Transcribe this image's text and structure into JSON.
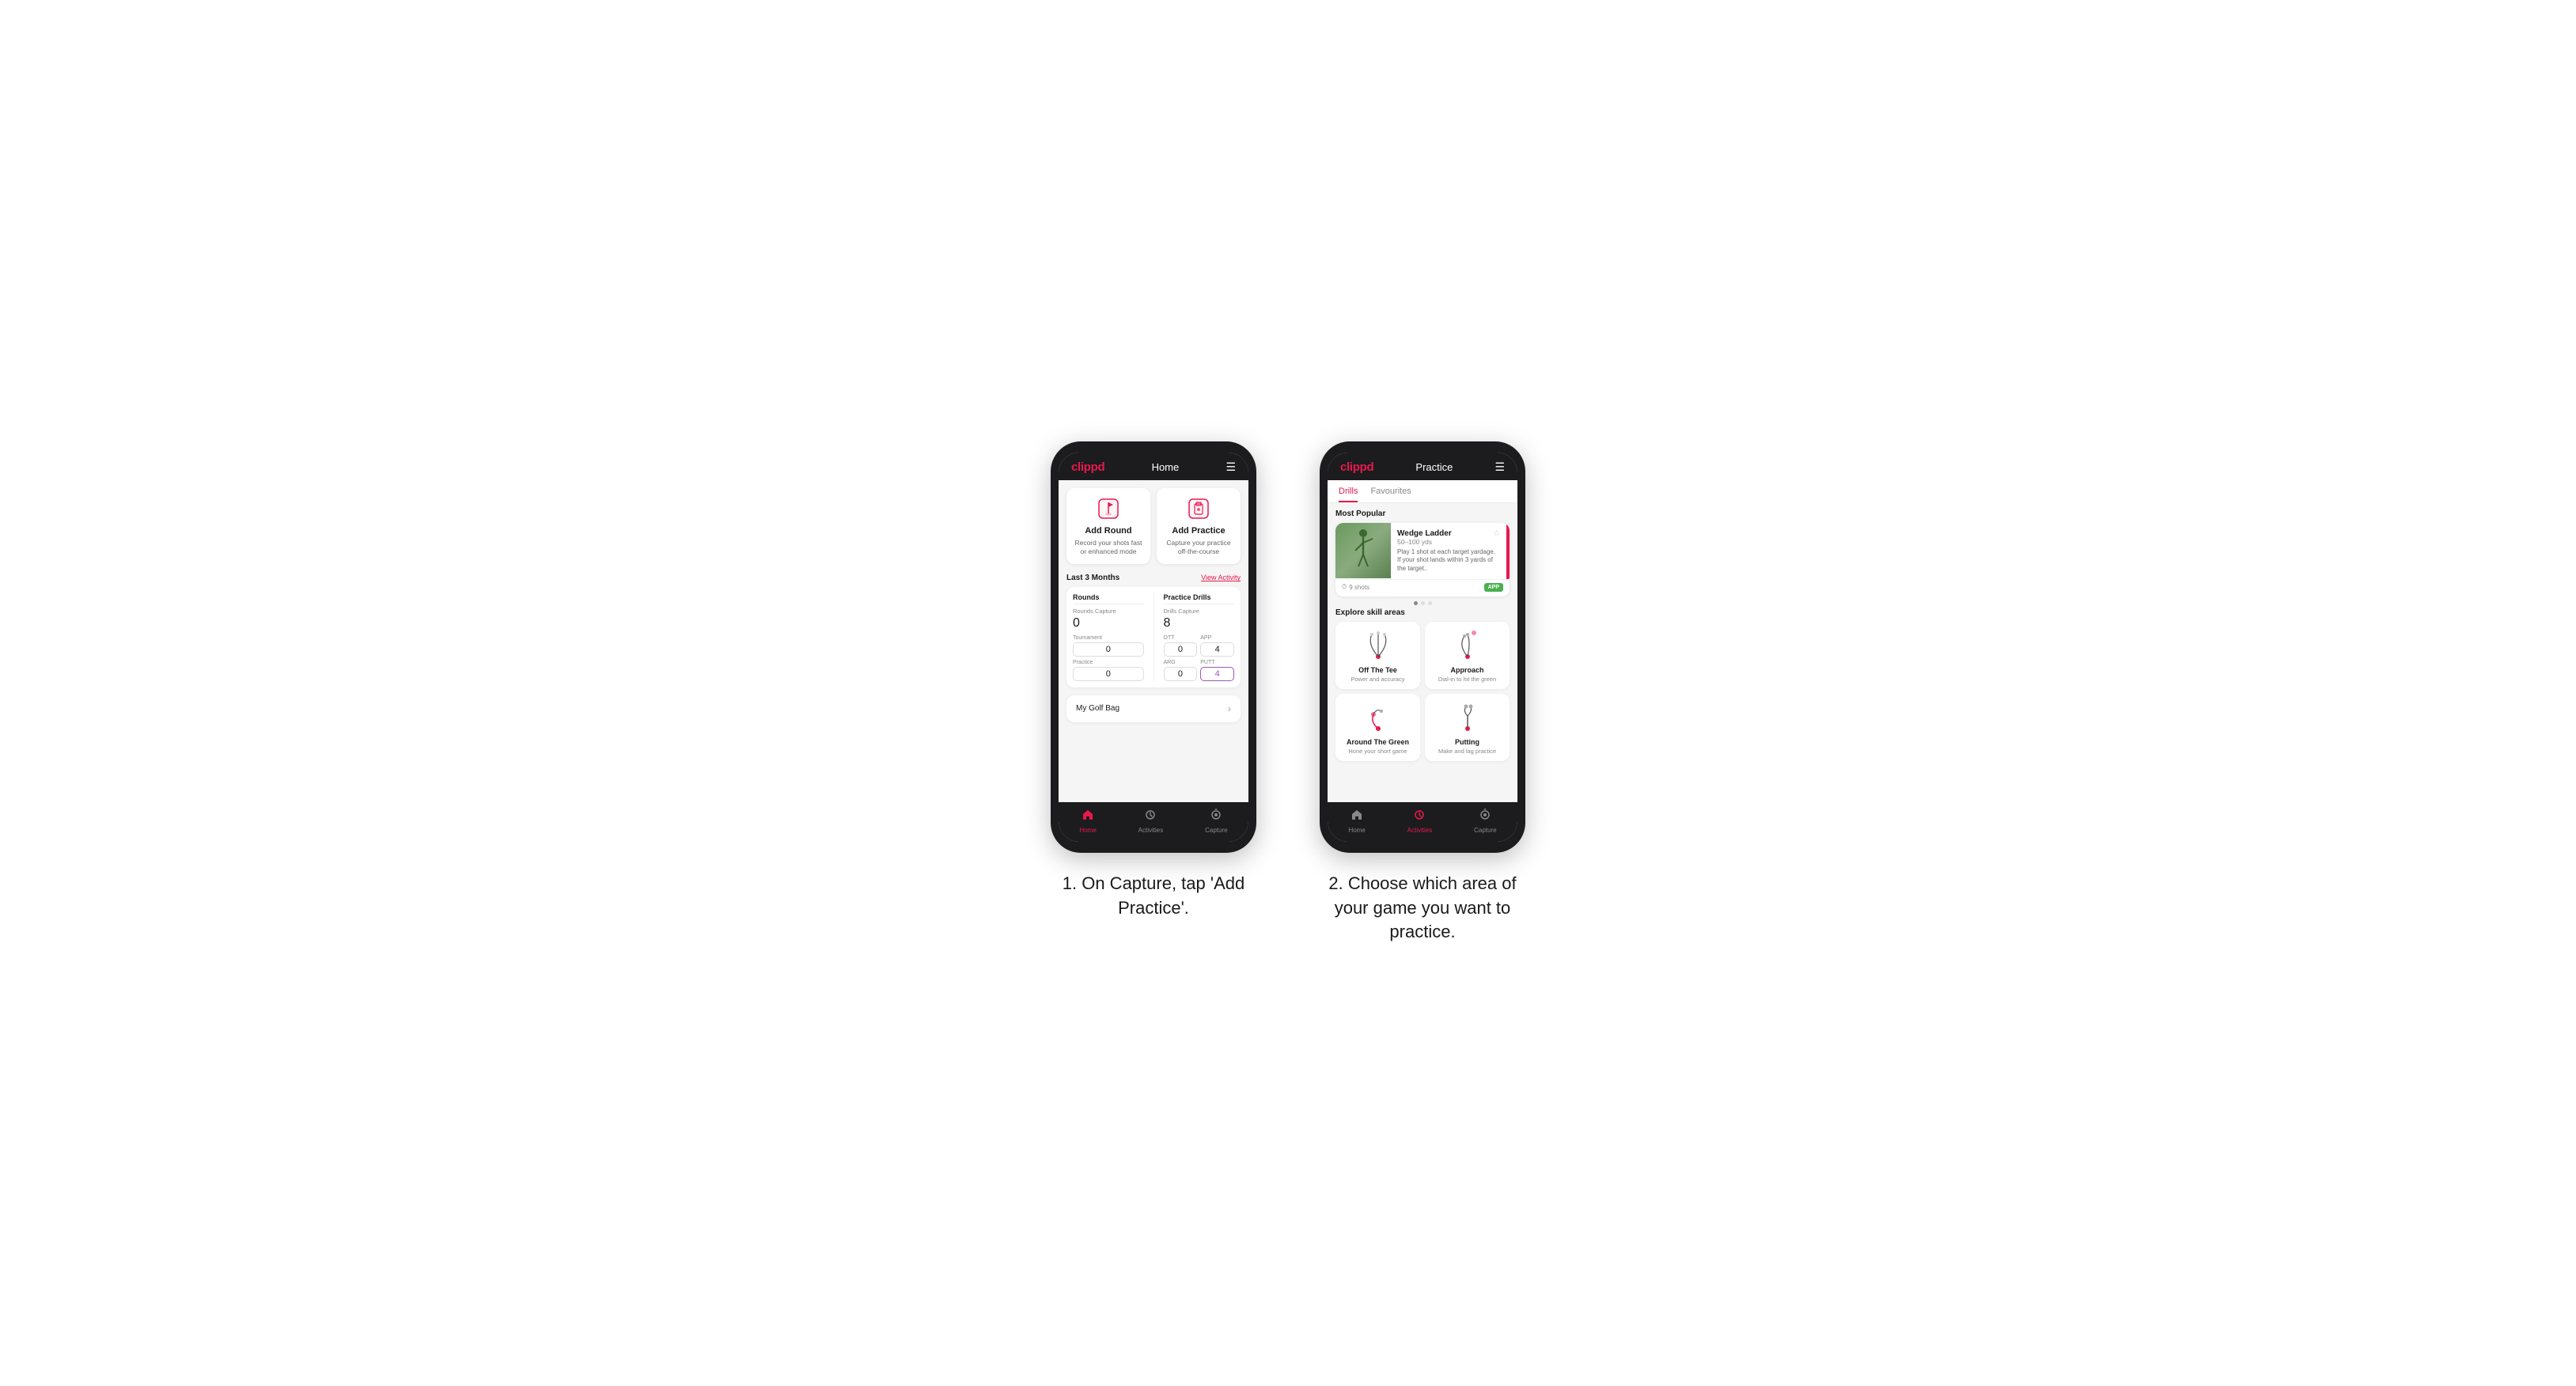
{
  "phone1": {
    "header": {
      "logo": "clippd",
      "title": "Home",
      "menu_icon": "☰"
    },
    "add_round": {
      "title": "Add Round",
      "description": "Record your shots fast or enhanced mode"
    },
    "add_practice": {
      "title": "Add Practice",
      "description": "Capture your practice off-the-course"
    },
    "stats": {
      "period": "Last 3 Months",
      "view_activity": "View Activity",
      "rounds_label": "Rounds",
      "rounds_capture_label": "Rounds Capture",
      "rounds_value": "0",
      "tournament_label": "Tournament",
      "tournament_value": "0",
      "practice_label": "Practice",
      "practice_value": "0",
      "practice_drills_label": "Practice Drills",
      "drills_capture_label": "Drills Capture",
      "drills_value": "8",
      "ott_label": "OTT",
      "ott_value": "0",
      "app_label": "APP",
      "app_value": "4",
      "arg_label": "ARG",
      "arg_value": "0",
      "putt_label": "PUTT",
      "putt_value": "4"
    },
    "golf_bag": {
      "label": "My Golf Bag"
    },
    "nav": {
      "home": "Home",
      "activities": "Activities",
      "capture": "Capture"
    }
  },
  "phone2": {
    "header": {
      "logo": "clippd",
      "title": "Practice",
      "menu_icon": "☰"
    },
    "tabs": {
      "drills": "Drills",
      "favourites": "Favourites"
    },
    "most_popular": "Most Popular",
    "featured_drill": {
      "title": "Wedge Ladder",
      "yardage": "50–100 yds",
      "description": "Play 1 shot at each target yardage. If your shot lands within 3 yards of the target..",
      "shots": "9 shots",
      "badge": "APP"
    },
    "pagination": {
      "dots": 3,
      "active_dot": 0
    },
    "explore": "Explore skill areas",
    "skills": [
      {
        "title": "Off The Tee",
        "description": "Power and accuracy",
        "diagram_type": "tee"
      },
      {
        "title": "Approach",
        "description": "Dial-in to hit the green",
        "diagram_type": "approach"
      },
      {
        "title": "Around The Green",
        "description": "Hone your short game",
        "diagram_type": "atg"
      },
      {
        "title": "Putting",
        "description": "Make and lag practice",
        "diagram_type": "putt"
      }
    ],
    "nav": {
      "home": "Home",
      "activities": "Activities",
      "capture": "Capture"
    }
  },
  "captions": {
    "phone1": "1. On Capture, tap 'Add Practice'.",
    "phone2": "2. Choose which area of your game you want to practice."
  }
}
